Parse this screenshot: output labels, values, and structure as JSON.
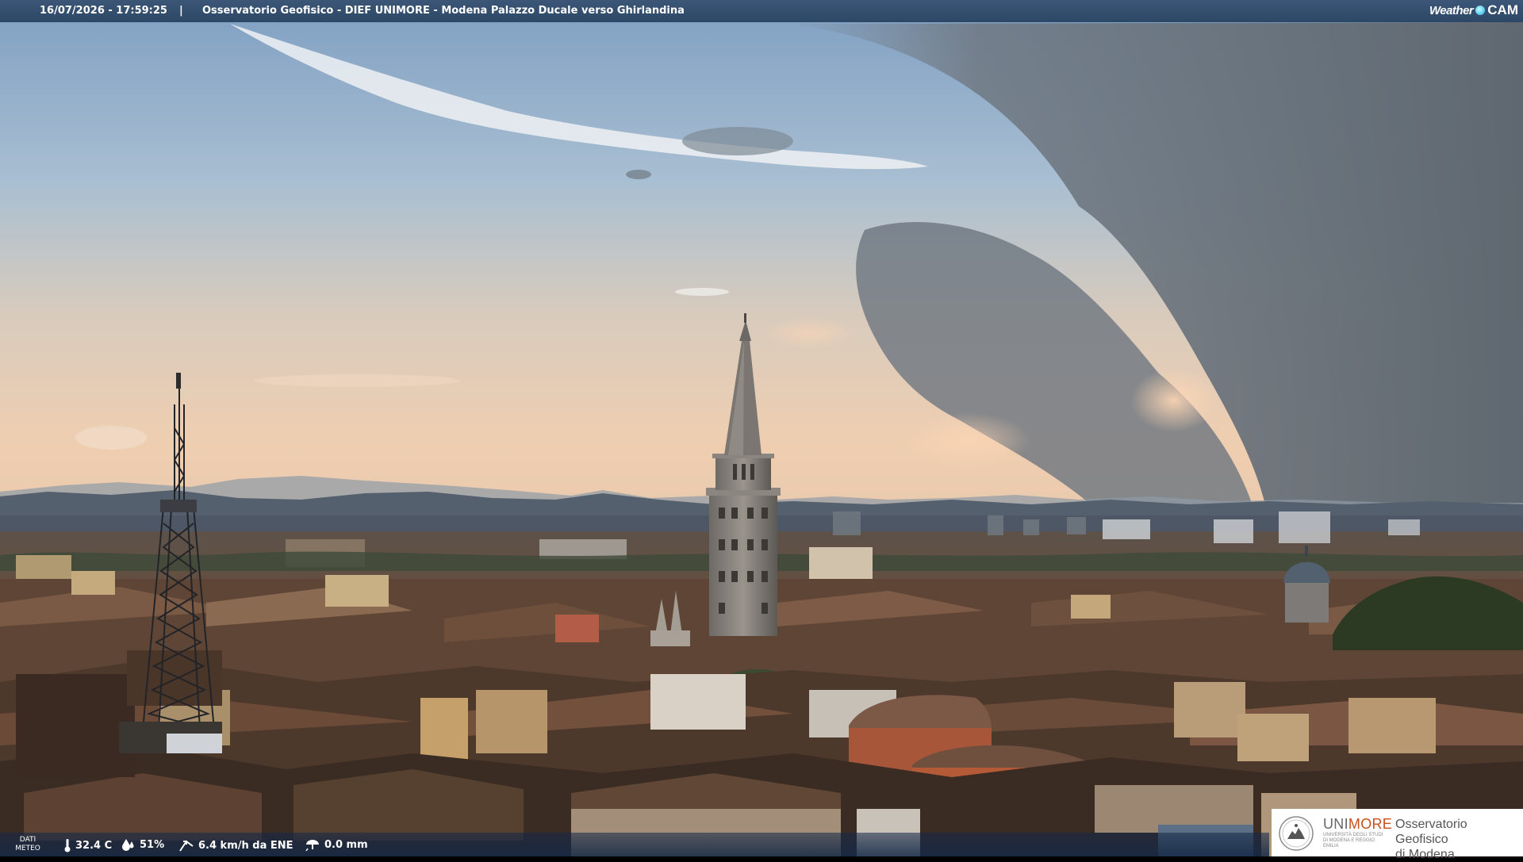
{
  "header": {
    "timestamp": "16/07/2026 - 17:59:25",
    "separator": "|",
    "title": "Osservatorio Geofisico - DIEF UNIMORE - Modena Palazzo Ducale verso Ghirlandina",
    "brand_weather": "Weather",
    "brand_cam": "CAM"
  },
  "footer": {
    "dati_meteo": "DATI METEO",
    "temperature": "32.4 C",
    "humidity": "51%",
    "wind": "6.4 km/h da ENE",
    "rain": "0.0 mm",
    "icons": [
      "thermometer-icon",
      "humidity-drop-icon",
      "wind-icon",
      "rain-icon"
    ]
  },
  "logo": {
    "uni_part1": "UNI",
    "uni_part2": "MORE",
    "uni_sub": "UNIVERSITÀ DEGLI STUDI DI MODENA E REGGIO EMILIA",
    "osservatorio_line1": "Osservatorio Geofisico",
    "osservatorio_line2": "di Modena"
  },
  "colors": {
    "header_bg": "#34506f",
    "accent_orange": "#c7501c",
    "sky_blue": "#8aaac9",
    "storm_gray": "#6c7680",
    "sunset_peach": "#e9c7a6",
    "roof_brown": "#6a4a38"
  }
}
